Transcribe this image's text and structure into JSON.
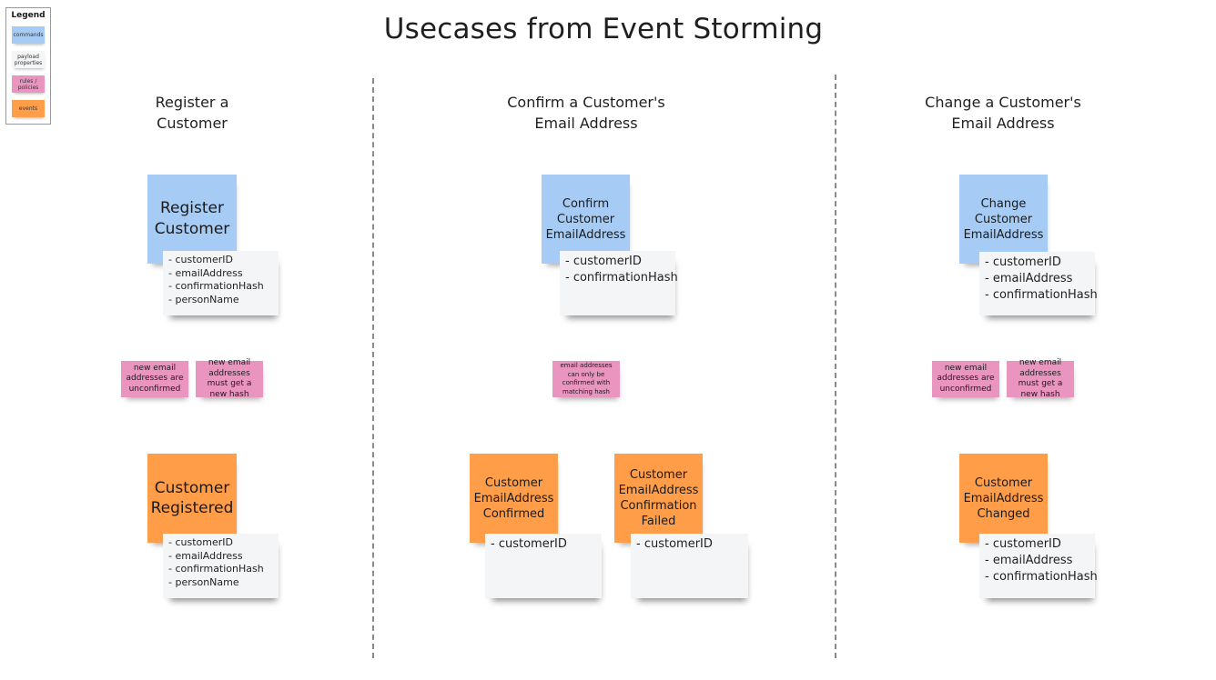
{
  "title": "Usecases from Event Storming",
  "legend": {
    "title": "Legend",
    "items": [
      {
        "label": "commands",
        "color": "#a6ccf5"
      },
      {
        "label": "payload properties",
        "color": "#f4f5f6"
      },
      {
        "label": "rules / policies",
        "color": "#ea94c0"
      },
      {
        "label": "events",
        "color": "#ff9d48"
      }
    ]
  },
  "columns": [
    {
      "title_line1": "Register a",
      "title_line2": "Customer",
      "command": {
        "label": "Register Customer",
        "payload": [
          "- customerID",
          "- emailAddress",
          "- confirmationHash",
          "- personName"
        ]
      },
      "rules": [
        "new email addresses are unconfirmed",
        "new email addresses must get a new hash"
      ],
      "events": [
        {
          "label": "Customer Registered",
          "payload": [
            "- customerID",
            "- emailAddress",
            "- confirmationHash",
            "- personName"
          ]
        }
      ]
    },
    {
      "title_line1": "Confirm a Customer's",
      "title_line2": "Email Address",
      "command": {
        "label": "Confirm Customer EmailAddress",
        "payload": [
          "- customerID",
          "- confirmationHash"
        ]
      },
      "rules": [
        "email addresses can only be confirmed with matching hash"
      ],
      "events": [
        {
          "label": "Customer EmailAddress Confirmed",
          "payload": [
            "- customerID"
          ]
        },
        {
          "label": "Customer EmailAddress Confirmation Failed",
          "payload": [
            "- customerID"
          ]
        }
      ]
    },
    {
      "title_line1": "Change a Customer's",
      "title_line2": "Email Address",
      "command": {
        "label": "Change Customer EmailAddress",
        "payload": [
          "- customerID",
          "- emailAddress",
          "- confirmationHash"
        ]
      },
      "rules": [
        "new email addresses are unconfirmed",
        "new email addresses must get a new hash"
      ],
      "events": [
        {
          "label": "Customer EmailAddress Changed",
          "payload": [
            "- customerID",
            "- emailAddress",
            "- confirmationHash"
          ]
        }
      ]
    }
  ]
}
